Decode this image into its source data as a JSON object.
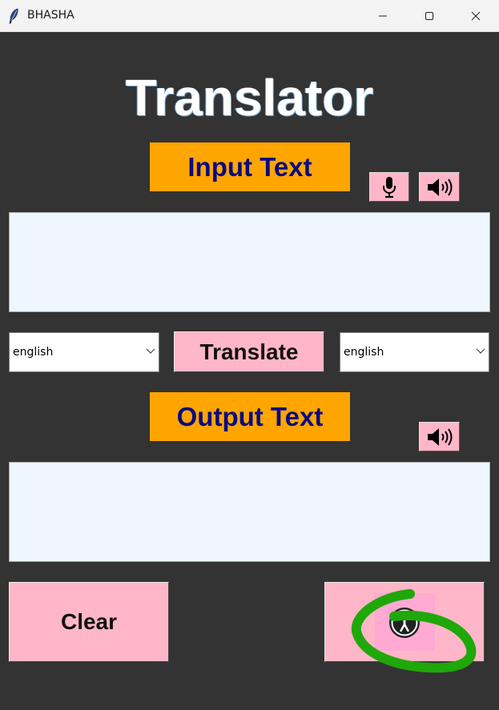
{
  "window": {
    "title": "BHASHA",
    "app_icon": "feather-icon",
    "controls": [
      "minimize-icon",
      "maximize-icon",
      "close-icon"
    ]
  },
  "main": {
    "heading": "Translator",
    "input_label": "Input Text",
    "output_label": "Output Text",
    "input_text": "",
    "output_text": "",
    "source_language": "english",
    "target_language": "english",
    "translate_label": "Translate",
    "clear_label": "Clear",
    "icons": {
      "mic": "microphone-icon",
      "speak_input": "speaker-icon",
      "speak_output": "speaker-icon",
      "accessibility": "accessibility-icon"
    }
  },
  "colors": {
    "background": "#333333",
    "label_background": "#ffa500",
    "label_text": "#0a0a80",
    "button_background": "#ffb6c8",
    "text_area_background": "#eef6ff",
    "annotation_stroke": "#1fa80a"
  }
}
